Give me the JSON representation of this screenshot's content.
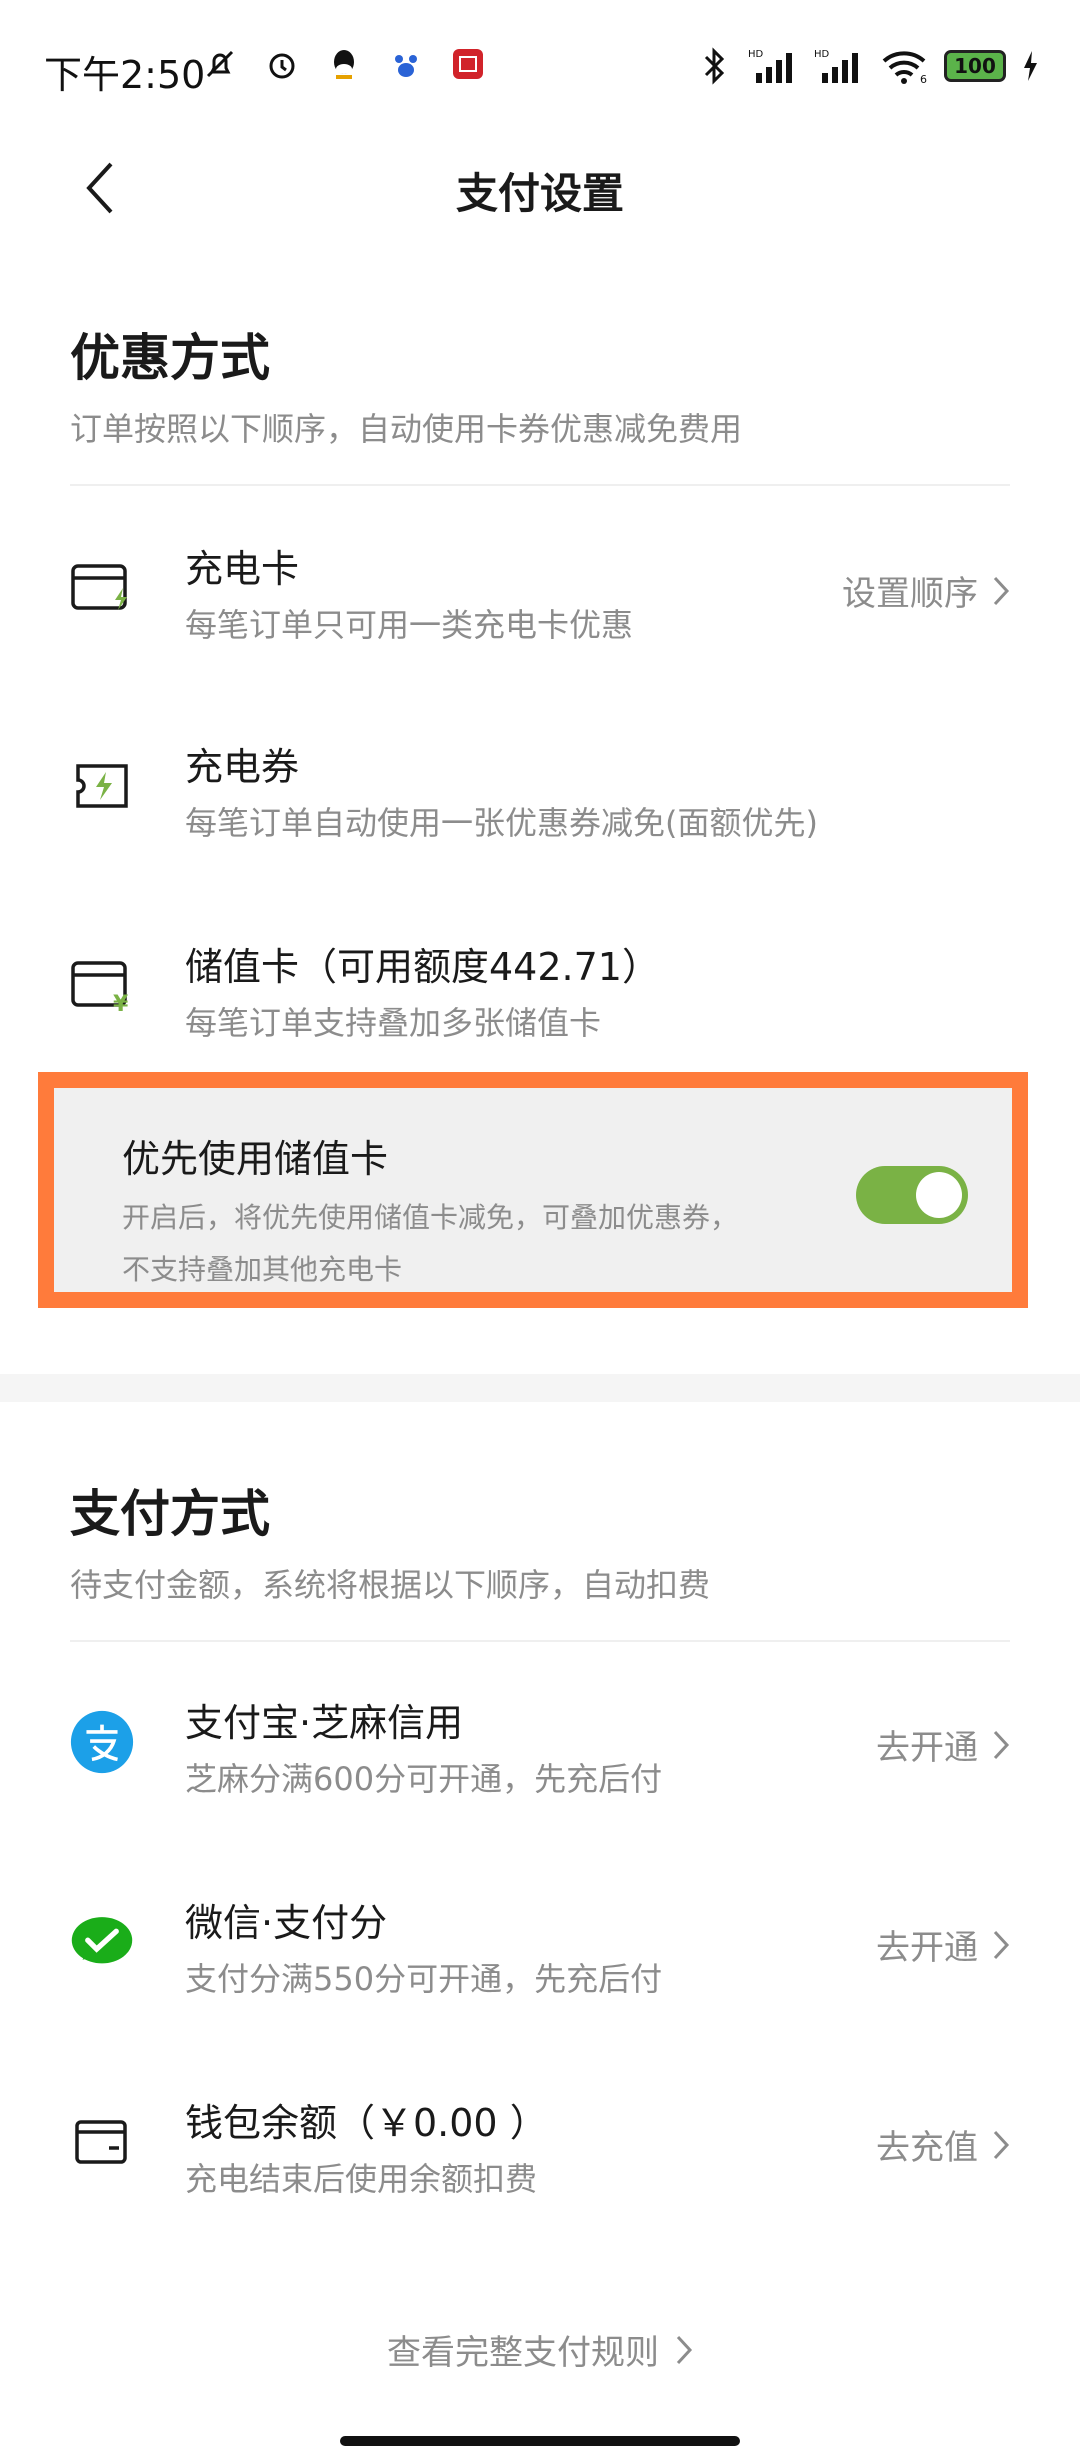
{
  "status_bar": {
    "time": "下午2:50",
    "battery": "100",
    "signal_label_1": "HD",
    "signal_label_2": "HD",
    "wifi_label": "6"
  },
  "nav": {
    "title": "支付设置"
  },
  "discount_section": {
    "title": "优惠方式",
    "subtitle": "订单按照以下顺序，自动使用卡券优惠减免费用",
    "items": [
      {
        "title": "充电卡",
        "desc": "每笔订单只可用一类充电卡优惠",
        "action": "设置顺序",
        "icon": "charge-card-icon"
      },
      {
        "title": "充电券",
        "desc": "每笔订单自动使用一张优惠券减免(面额优先)",
        "icon": "charge-coupon-icon"
      },
      {
        "title": "储值卡（可用额度442.71）",
        "desc": "每笔订单支持叠加多张储值卡",
        "icon": "stored-value-card-icon"
      }
    ],
    "priority": {
      "title": "优先使用储值卡",
      "desc": "开启后，将优先使用储值卡减免，可叠加优惠券，不支持叠加其他充电卡",
      "enabled": true
    }
  },
  "payment_section": {
    "title": "支付方式",
    "subtitle": "待支付金额，系统将根据以下顺序，自动扣费",
    "items": [
      {
        "title": "支付宝·芝麻信用",
        "desc": "芝麻分满600分可开通，先充后付",
        "action": "去开通",
        "icon": "alipay-icon"
      },
      {
        "title": "微信·支付分",
        "desc": "支付分满550分可开通，先充后付",
        "action": "去开通",
        "icon": "wechat-pay-icon"
      },
      {
        "title": "钱包余额（￥0.00 ）",
        "desc": "充电结束后使用余额扣费",
        "action": "去充值",
        "icon": "wallet-icon"
      }
    ]
  },
  "footer": {
    "link": "查看完整支付规则"
  },
  "colors": {
    "accent_green": "#7ab245",
    "highlight_orange": "#ff7b3b",
    "alipay_blue": "#1ca0e8",
    "wechat_green": "#1aad19"
  }
}
